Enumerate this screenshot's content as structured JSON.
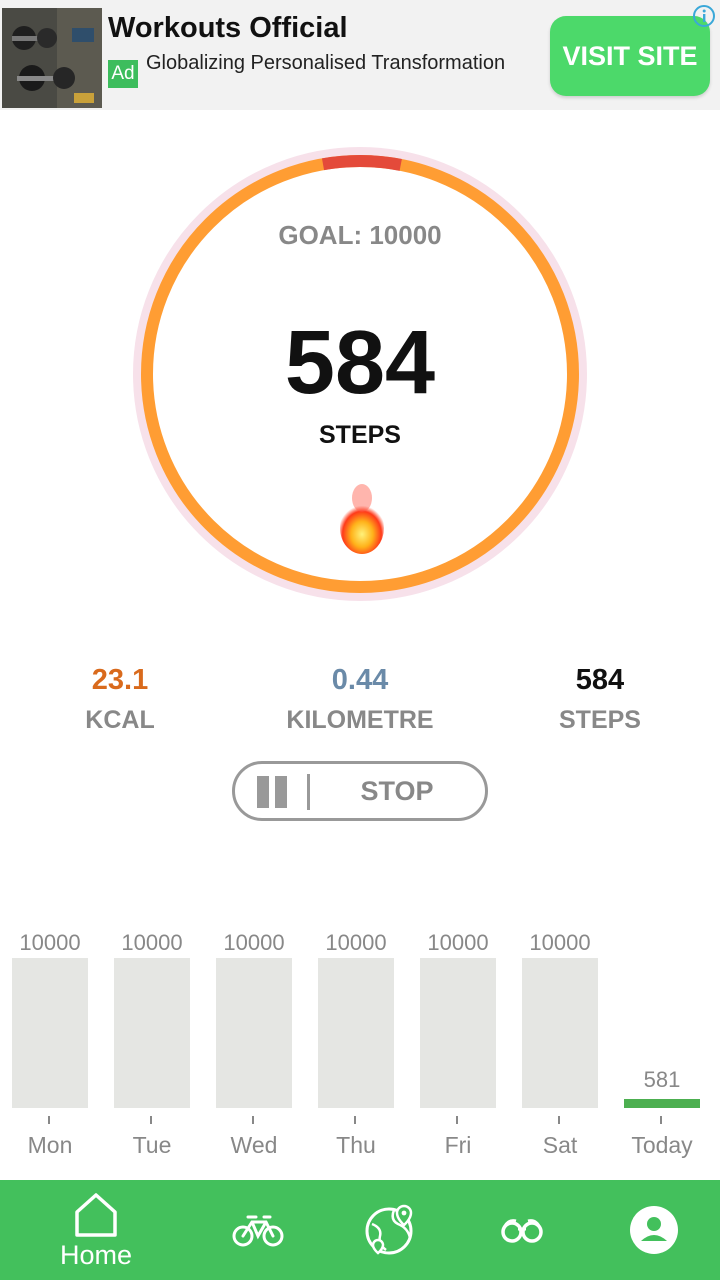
{
  "ad": {
    "title": "Workouts Official",
    "badge": "Ad",
    "description": "Globalizing Personalised Transformation",
    "cta": "VISIT SITE",
    "info_icon": "info-icon",
    "image": "dumbbells-photo"
  },
  "progress": {
    "goal_text": "GOAL: 10000",
    "steps": "584",
    "steps_label": "STEPS",
    "fraction": 0.0584,
    "colors": {
      "ring": "#ff9d33",
      "progress": "#e44a3a",
      "halo": "#f7e1ea"
    }
  },
  "stats": [
    {
      "value": "23.1",
      "label": "KCAL"
    },
    {
      "value": "0.44",
      "label": "KILOMETRE"
    },
    {
      "value": "584",
      "label": "STEPS"
    }
  ],
  "controls": {
    "pause_icon": "pause-icon",
    "stop_label": "STOP"
  },
  "week": {
    "days": [
      {
        "label": "Mon",
        "value": "10000",
        "fraction": 1
      },
      {
        "label": "Tue",
        "value": "10000",
        "fraction": 1
      },
      {
        "label": "Wed",
        "value": "10000",
        "fraction": 1
      },
      {
        "label": "Thu",
        "value": "10000",
        "fraction": 1
      },
      {
        "label": "Fri",
        "value": "10000",
        "fraction": 1
      },
      {
        "label": "Sat",
        "value": "10000",
        "fraction": 1
      },
      {
        "label": "Today",
        "value": "581",
        "fraction": 0.0581
      }
    ],
    "colors": {
      "bar": "#e5e6e3",
      "today": "#4caf50"
    }
  },
  "nav": {
    "items": [
      {
        "label": "Home",
        "icon": "home-icon",
        "active": true
      },
      {
        "label": "",
        "icon": "bicycle-icon"
      },
      {
        "label": "",
        "icon": "map-globe-icon"
      },
      {
        "label": "",
        "icon": "binoculars-icon"
      },
      {
        "label": "",
        "icon": "profile-icon"
      }
    ],
    "color": "#43c05c"
  }
}
